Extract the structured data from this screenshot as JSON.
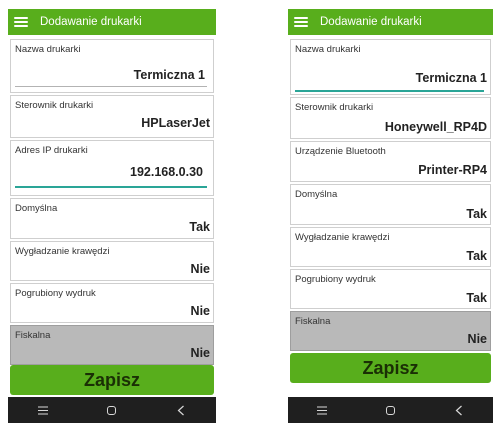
{
  "left_screen": {
    "title": "Dodawanie drukarki",
    "fields": [
      {
        "label": "Nazwa drukarki",
        "value": "Termiczna 1"
      },
      {
        "label": "Sterownik drukarki",
        "value": "HPLaserJet"
      },
      {
        "label": "Adres IP drukarki",
        "value": "192.168.0.30"
      },
      {
        "label": "Domyślna",
        "value": "Tak"
      },
      {
        "label": "Wygładzanie krawędzi",
        "value": "Nie"
      },
      {
        "label": "Pogrubiony wydruk",
        "value": "Nie"
      },
      {
        "label": "Fiskalna",
        "value": "Nie"
      }
    ],
    "save_label": "Zapisz"
  },
  "right_screen": {
    "title": "Dodawanie drukarki",
    "fields": [
      {
        "label": "Nazwa drukarki",
        "value": "Termiczna 1"
      },
      {
        "label": "Sterownik drukarki",
        "value": "Honeywell_RP4D"
      },
      {
        "label": "Urządzenie Bluetooth",
        "value": "Printer-RP4"
      },
      {
        "label": "Domyślna",
        "value": "Tak"
      },
      {
        "label": "Wygładzanie krawędzi",
        "value": "Tak"
      },
      {
        "label": "Pogrubiony wydruk",
        "value": "Tak"
      },
      {
        "label": "Fiskalna",
        "value": "Nie"
      }
    ],
    "save_label": "Zapisz"
  },
  "icons": {
    "menu": "hamburger-menu-icon",
    "nav_recents": "recents-icon",
    "nav_home": "home-icon",
    "nav_back": "back-icon"
  },
  "colors": {
    "accent_green": "#58ae1c",
    "active_underline": "#2aa597",
    "disabled_field": "#b9b9b9",
    "navbar": "#1f1f1f"
  }
}
